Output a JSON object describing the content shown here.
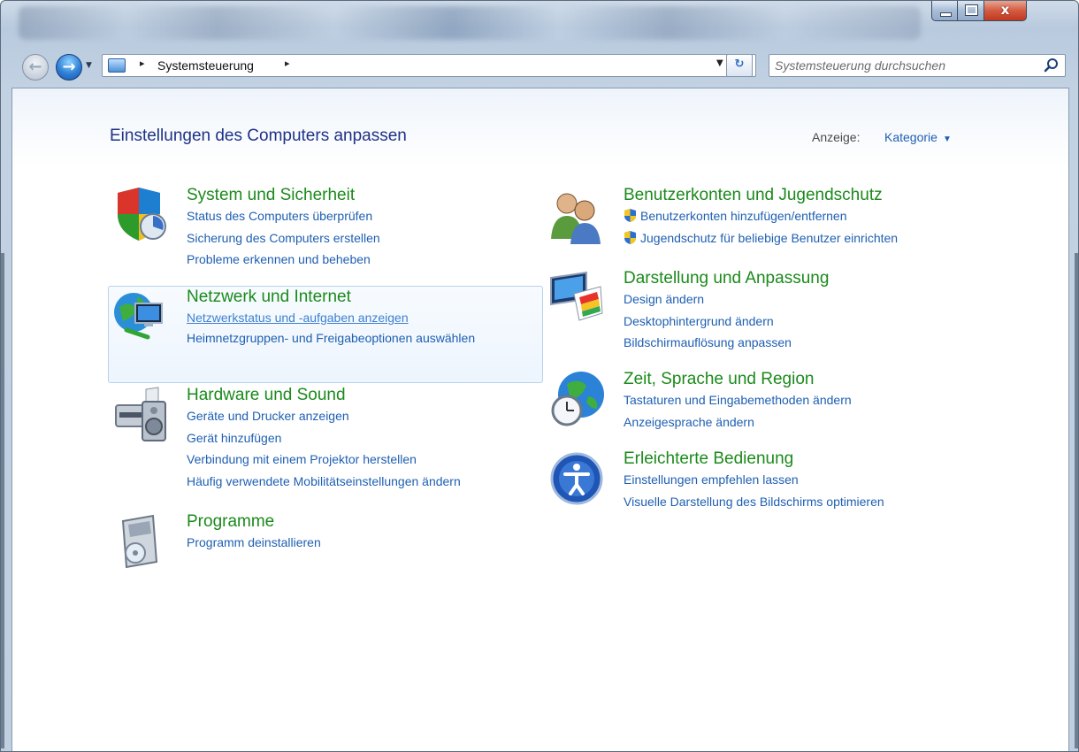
{
  "window": {
    "close_glyph": "x"
  },
  "nav": {
    "back_glyph": "←",
    "forward_glyph": "→",
    "dropdown_glyph": "▼",
    "refresh_glyph": "↻"
  },
  "address": {
    "separator": "▸",
    "path": "Systemsteuerung",
    "trailing_separator": "▸",
    "dropdown_glyph": "▼"
  },
  "search": {
    "placeholder": "Systemsteuerung durchsuchen"
  },
  "header": {
    "title": "Einstellungen des Computers anpassen",
    "view_label": "Anzeige:",
    "view_value": "Kategorie",
    "view_chevron": "▼"
  },
  "categories": [
    {
      "title": "System und Sicherheit",
      "icon": "shield-icon",
      "links": [
        "Status des Computers überprüfen",
        "Sicherung des Computers erstellen",
        "Probleme erkennen und beheben"
      ]
    },
    {
      "title": "Netzwerk und Internet",
      "icon": "network-icon",
      "links": [
        "Netzwerkstatus und -aufgaben anzeigen",
        "Heimnetzgruppen- und Freigabeoptionen auswählen"
      ]
    },
    {
      "title": "Hardware und Sound",
      "icon": "printer-icon",
      "links": [
        "Geräte und Drucker anzeigen",
        "Gerät hinzufügen",
        "Verbindung mit einem Projektor herstellen",
        "Häufig verwendete Mobilitätseinstellungen ändern"
      ]
    },
    {
      "title": "Programme",
      "icon": "programs-icon",
      "links": [
        "Programm deinstallieren"
      ]
    },
    {
      "title": "Benutzerkonten und Jugendschutz",
      "icon": "users-icon",
      "links": [
        "Benutzerkonten hinzufügen/entfernen",
        "Jugendschutz für beliebige Benutzer einrichten"
      ]
    },
    {
      "title": "Darstellung und Anpassung",
      "icon": "display-icon",
      "links": [
        "Design ändern",
        "Desktophintergrund ändern",
        "Bildschirmauflösung anpassen"
      ]
    },
    {
      "title": "Zeit, Sprache und Region",
      "icon": "globe-clock-icon",
      "links": [
        "Tastaturen und Eingabemethoden ändern",
        "Anzeigesprache ändern"
      ]
    },
    {
      "title": "Erleichterte Bedienung",
      "icon": "accessibility-icon",
      "links": [
        "Einstellungen empfehlen lassen",
        "Visuelle Darstellung des Bildschirms optimieren"
      ]
    }
  ],
  "colors": {
    "category_title": "#1b8a1b",
    "link": "#1e5fb2",
    "page_title": "#1e3287"
  }
}
